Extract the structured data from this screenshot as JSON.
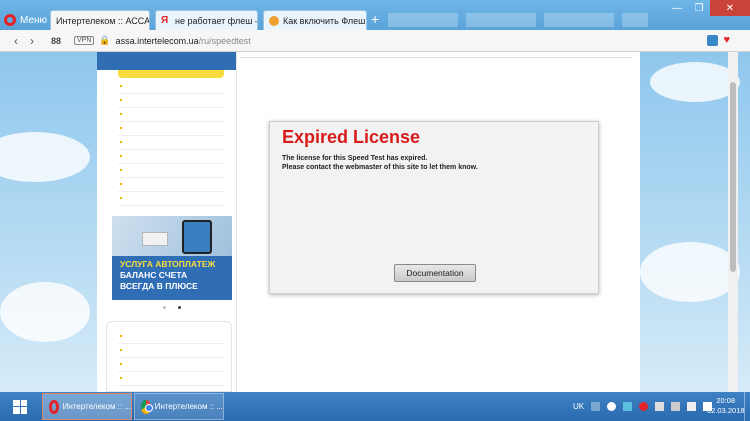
{
  "browser": {
    "menu_label": "Меню",
    "tabs": [
      {
        "label": "Интертелеком :: АССА",
        "active": true
      },
      {
        "label": "не работает флеш — Янд"
      },
      {
        "label": "Как включить Флеш Плеер"
      }
    ],
    "url_domain": "assa.intertelecom.ua",
    "url_path": "/ru/speedtest",
    "vpn_label": "VPN"
  },
  "site": {
    "banner_lines": [
      "УСЛУГА АВТОПЛАТЕЖ",
      "БАЛАНС СЧЕТА",
      "ВСЕГДА В ПЛЮСЕ"
    ]
  },
  "license_box": {
    "title": "Expired License",
    "line1": "The license for this Speed Test has expired.",
    "line2": "Please contact the webmaster of this site to let them know.",
    "button": "Documentation"
  },
  "taskbar": {
    "items": [
      {
        "label": "Интертелеком :: ..."
      },
      {
        "label": "Интертелеком :: ..."
      }
    ],
    "lang": "UK",
    "time": "20:08",
    "date": "02.03.2018"
  }
}
